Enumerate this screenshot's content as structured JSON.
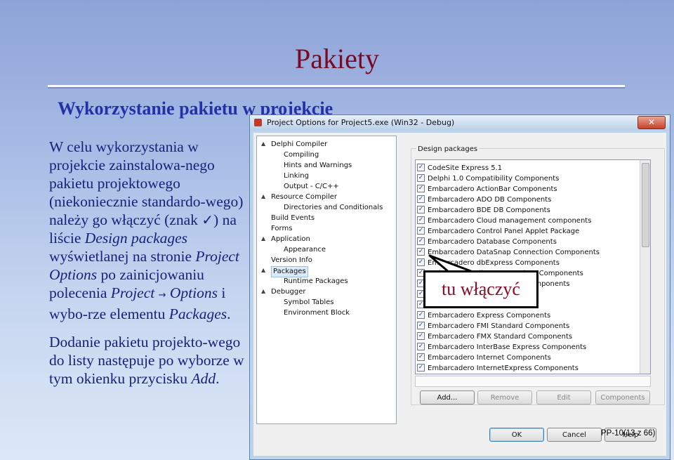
{
  "slide": {
    "title": "Pakiety",
    "subtitle": "Wykorzystanie pakietu w projekcie",
    "p1_a": "W celu wykorzystania w projekcie zainstalowa-nego pakietu projektowego (niekoniecznie standardo-wego) należy go włączyć (znak ",
    "p1_check": "✓",
    "p1_b": ") na liście ",
    "p1_design": "Design packages",
    "p1_c": " wyświetlanej na stronie ",
    "p1_po": "Project Options",
    "p1_d": " po zainicjowaniu polecenia ",
    "p1_project": "Project",
    "p1_arrow": "→",
    "p1_options": " Options",
    "p1_e": " i wybo-rze elementu ",
    "p1_packages": "Packages",
    "p1_f": ".",
    "p2_a": "Dodanie pakietu projekto-wego do listy następuje po wyborze w tym okienku przycisku ",
    "p2_add": "Add",
    "p2_b": ".",
    "callout": "tu włączyć",
    "page_number": "PP-10(13 z 66)"
  },
  "dialog": {
    "title": "Project Options for Project5.exe  (Win32 - Debug)",
    "close": "✕",
    "group_label": "Design packages",
    "tree": [
      {
        "label": "Delphi Compiler",
        "level": 0,
        "toggle": "▲"
      },
      {
        "label": "Compiling",
        "level": 1
      },
      {
        "label": "Hints and Warnings",
        "level": 1
      },
      {
        "label": "Linking",
        "level": 1
      },
      {
        "label": "Output - C/C++",
        "level": 1
      },
      {
        "label": "Resource Compiler",
        "level": 0,
        "toggle": "▲"
      },
      {
        "label": "Directories and Conditionals",
        "level": 1
      },
      {
        "label": "Build Events",
        "level": 0
      },
      {
        "label": "Forms",
        "level": 0
      },
      {
        "label": "Application",
        "level": 0,
        "toggle": "▲"
      },
      {
        "label": "Appearance",
        "level": 1
      },
      {
        "label": "Version Info",
        "level": 0
      },
      {
        "label": "Packages",
        "level": 0,
        "toggle": "▲",
        "selected": true
      },
      {
        "label": "Runtime Packages",
        "level": 1
      },
      {
        "label": "Debugger",
        "level": 0,
        "toggle": "▲"
      },
      {
        "label": "Symbol Tables",
        "level": 1
      },
      {
        "label": "Environment Block",
        "level": 1
      }
    ],
    "packages": [
      "CodeSite Express 5.1",
      "Delphi 1.0 Compatibility Components",
      "Embarcadero ActionBar Components",
      "Embarcadero ADO DB Components",
      "Embarcadero BDE DB Components",
      "Embarcadero Cloud management components",
      "Embarcadero Control Panel Applet Package",
      "Embarcadero Database Components",
      "Embarcadero DataSnap Connection Components",
      "Embarcadero dbExpress Components",
      "Embarcadero dbExpress Driver Components",
      "Embarcadero DBExpress ... Components",
      "Embarcadero ... Components",
      "Embarcadero ... Components",
      "Embarcadero Express Components",
      "Embarcadero FMI Standard Components",
      "Embarcadero FMX Standard Components",
      "Embarcadero InterBase Express Components",
      "Embarcadero Internet Components",
      "Embarcadero InternetExpress Components"
    ],
    "checkmark": "✓",
    "buttons": {
      "add": "Add...",
      "remove": "Remove",
      "edit": "Edit",
      "components": "Components",
      "ok": "OK",
      "cancel": "Cancel",
      "help": "Help"
    }
  }
}
